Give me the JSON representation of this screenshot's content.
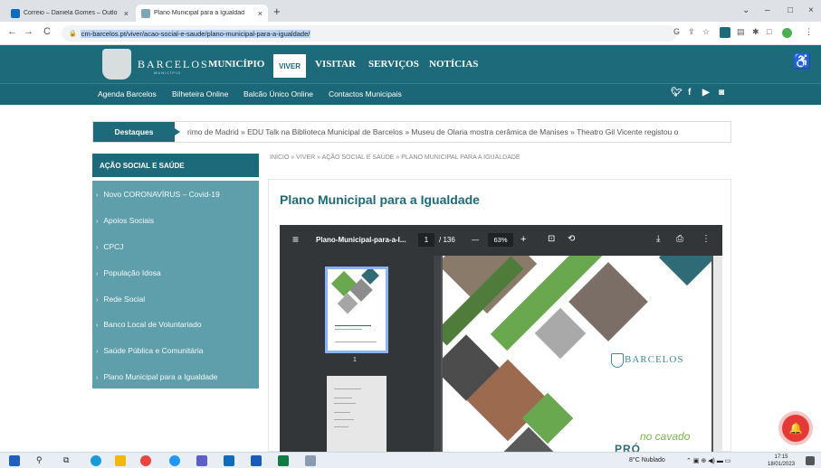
{
  "browser": {
    "tabs": [
      {
        "title": "Correio – Daniela Gomes – Outlo",
        "favicon": "outlook-icon",
        "close": "×"
      },
      {
        "title": "Plano Municipal para a Igualdad",
        "favicon": "barcelos-crest-icon",
        "close": "×"
      }
    ],
    "new_tab": "+",
    "window_controls": [
      "⌄",
      "–",
      "□",
      "×"
    ],
    "nav": {
      "back": "←",
      "forward": "→",
      "reload": "C"
    },
    "url": "cm-barcelos.pt/viver/acao-social-e-saude/plano-municipal-para-a-igualdade/",
    "lock": "🔒"
  },
  "site": {
    "brand": "BARCELOS",
    "brand_sub": "MUNICÍPIO",
    "nav": [
      "MUNICÍPIO",
      "VIVER",
      "VISITAR",
      "SERVIÇOS",
      "NOTÍCIAS"
    ],
    "active_nav": "VIVER",
    "accessibility_icon": "♿",
    "subnav": [
      "Agenda Barcelos",
      "Bilheteira Online",
      "Balcão Único Online",
      "Contactos Municipais"
    ],
    "social": [
      "twitter-icon",
      "facebook-icon",
      "youtube-icon",
      "instagram-icon"
    ],
    "social_glyphs": [
      "𝕪",
      "f",
      "▶",
      "◙"
    ]
  },
  "highlights": {
    "label": "Destaques",
    "text": "rimo de Madrid  »  EDU Talk na Biblioteca Municipal de Barcelos  »  Museu de Olaria mostra cerâmica de Manises  »  Theatro Gil Vicente registou o"
  },
  "sidebar": {
    "title": "AÇÃO SOCIAL E SAÚDE",
    "items": [
      "Novo CORONAVÍRUS – Covid-19",
      "Apoios Sociais",
      "CPCJ",
      "População Idosa",
      "Rede Social",
      "Banco Local de Voluntariado",
      "Saúde Pública e Comunitária",
      "Plano Municipal para a Igualdade"
    ]
  },
  "breadcrumb": "INÍCIO  »  VIVER  »  AÇÃO SOCIAL E SAÚDE  »  PLANO MUNICIPAL PARA A IGUALDADE",
  "page_title": "Plano Municipal para a Igualdade",
  "pdf": {
    "menu_icon": "≡",
    "filename": "Plano-Municipal-para-a-I...",
    "page_current": "1",
    "page_total": "/ 136",
    "zoom_out": "—",
    "zoom": "63%",
    "zoom_in": "+",
    "fit_icon": "⊡",
    "rotate_icon": "⟲",
    "download_icon": "⤓",
    "print_icon": "⎙",
    "more_icon": "⋮",
    "thumb_page": "1",
    "cover_brand": "BARCELOS",
    "cover_line1": "no cavado",
    "cover_line2": "PRÓ IGUALDADE"
  },
  "notification_icon": "🔔",
  "taskbar": {
    "weather": "8°C  Nublado",
    "tray": "⌃ ▣ ⊕ ◀) ▬ ▭",
    "time": "17:15",
    "date": "18/01/2023"
  }
}
